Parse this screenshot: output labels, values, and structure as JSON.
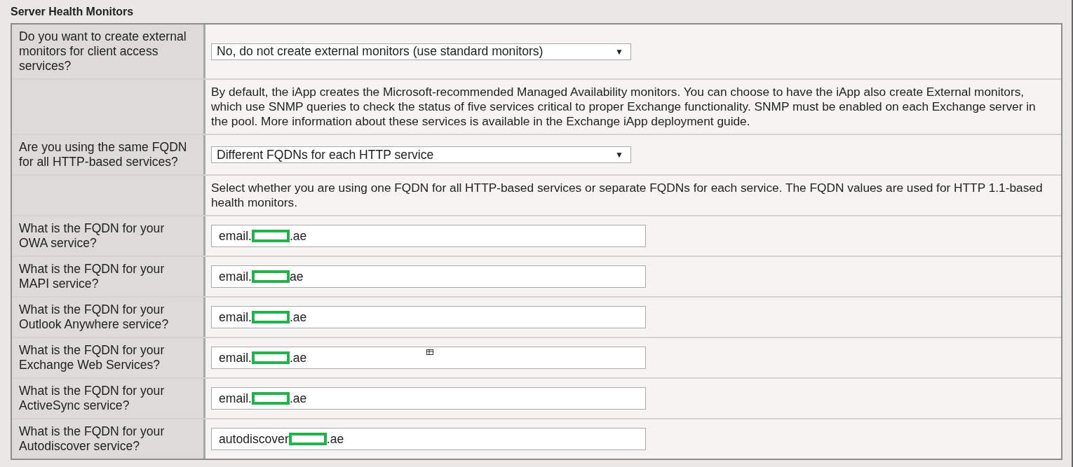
{
  "section_title": "Server Health Monitors",
  "rows": [
    {
      "kind": "select",
      "label": "Do you want to create external monitors for client access services?",
      "value": "No, do not create external monitors (use standard monitors)",
      "arrow": "▼"
    },
    {
      "kind": "note",
      "text": "By default, the iApp creates the Microsoft-recommended Managed Availability monitors. You can choose to have the iApp also create External monitors, which use SNMP queries to check the status of five services critical to proper Exchange functionality. SNMP must be enabled on each Exchange server in the pool. More information about these services is available in the Exchange iApp deployment guide."
    },
    {
      "kind": "select",
      "label": "Are you using the same FQDN for all HTTP-based services?",
      "value": "Different FQDNs for each HTTP service",
      "arrow": "▼"
    },
    {
      "kind": "note",
      "text": "Select whether you are using one FQDN for all HTTP-based services or separate FQDNs for each service. The FQDN values are used for HTTP 1.1-based health monitors."
    },
    {
      "kind": "input",
      "label": "What is the FQDN for your OWA service?",
      "text_before": "email.",
      "text_after": ".ae",
      "redacted": true
    },
    {
      "kind": "input",
      "label": "What is the FQDN for your MAPI service?",
      "text_before": "email.",
      "text_after": "ae",
      "redacted": true
    },
    {
      "kind": "input",
      "label": "What is the FQDN for your Outlook Anywhere service?",
      "text_before": "email.",
      "text_after": ".ae",
      "redacted": true
    },
    {
      "kind": "input",
      "label": "What is the FQDN for your Exchange Web Services?",
      "text_before": "email.",
      "text_after": ".ae",
      "redacted": true,
      "cursor_icon": true
    },
    {
      "kind": "input",
      "label": "What is the FQDN for your ActiveSync service?",
      "text_before": "email.",
      "text_after": ".ae",
      "redacted": true
    },
    {
      "kind": "input",
      "label": "What is the FQDN for your Autodiscover service?",
      "text_before": "autodiscover",
      "text_after": ".ae",
      "redacted": true
    }
  ]
}
